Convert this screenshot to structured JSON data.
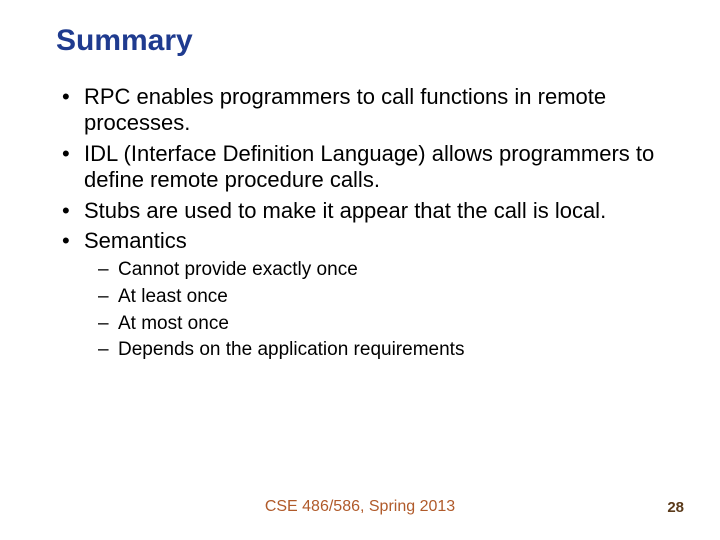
{
  "title": "Summary",
  "bullets": [
    "RPC enables programmers to call functions in remote processes.",
    "IDL (Interface Definition Language) allows programmers to define remote procedure calls.",
    "Stubs are used to make it appear that the call is local.",
    "Semantics"
  ],
  "sub": [
    "Cannot provide exactly once",
    "At least once",
    "At most once",
    "Depends on the application requirements"
  ],
  "footer": "CSE 486/586, Spring 2013",
  "page": "28"
}
